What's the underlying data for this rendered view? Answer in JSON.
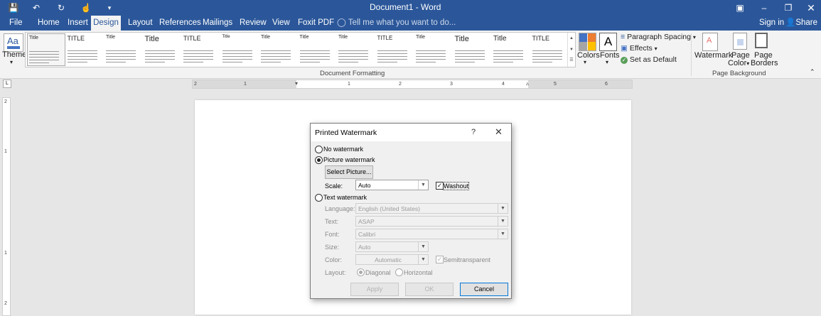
{
  "window": {
    "title": "Document1 - Word",
    "sign_in": "Sign in",
    "share": "Share"
  },
  "tabs": [
    "File",
    "Home",
    "Insert",
    "Design",
    "Layout",
    "References",
    "Mailings",
    "Review",
    "View",
    "Foxit PDF"
  ],
  "active_tab": "Design",
  "tell_me": "Tell me what you want to do...",
  "ribbon": {
    "themes_label": "Themes",
    "style_titles": [
      "Title",
      "TITLE",
      "Title",
      "Title",
      "TITLE",
      "Title",
      "Title",
      "Title",
      "Title",
      "TITLE",
      "Title",
      "Title",
      "Title",
      "TITLE"
    ],
    "group_document_formatting": "Document Formatting",
    "colors_label": "Colors",
    "fonts_label": "Fonts",
    "paragraph_spacing": "Paragraph Spacing",
    "effects": "Effects",
    "set_as_default": "Set as Default",
    "watermark": "Watermark",
    "page_color_1": "Page",
    "page_color_2": "Color",
    "page_borders_1": "Page",
    "page_borders_2": "Borders",
    "group_page_background": "Page Background"
  },
  "ruler": {
    "numbers": [
      "2",
      "1",
      "1",
      "2",
      "3",
      "4",
      "5",
      "6"
    ],
    "v_numbers": [
      "2",
      "1",
      "1",
      "2"
    ]
  },
  "dialog": {
    "title": "Printed Watermark",
    "help": "?",
    "no_watermark": "No watermark",
    "picture_watermark": "Picture watermark",
    "select_picture": "Select Picture...",
    "scale_label": "Scale:",
    "scale_value": "Auto",
    "washout": "Washout",
    "text_watermark": "Text watermark",
    "language_label": "Language:",
    "language_value": "English (United States)",
    "text_label": "Text:",
    "text_value": "ASAP",
    "font_label": "Font:",
    "font_value": "Calibri",
    "size_label": "Size:",
    "size_value": "Auto",
    "color_label": "Color:",
    "color_value": "Automatic",
    "semitransparent": "Semitransparent",
    "layout_label": "Layout:",
    "diagonal": "Diagonal",
    "horizontal": "Horizontal",
    "apply": "Apply",
    "ok": "OK",
    "cancel": "Cancel",
    "selected_option": "picture_watermark",
    "washout_checked": true,
    "semitransparent_checked": true,
    "layout_selected": "diagonal"
  },
  "colors": {
    "brand_blue": "#2b579a",
    "theme_swatch_1": "#4472c4",
    "theme_swatch_2": "#ed7d31",
    "theme_swatch_3": "#a5a5a5",
    "theme_swatch_4": "#ffc000"
  }
}
